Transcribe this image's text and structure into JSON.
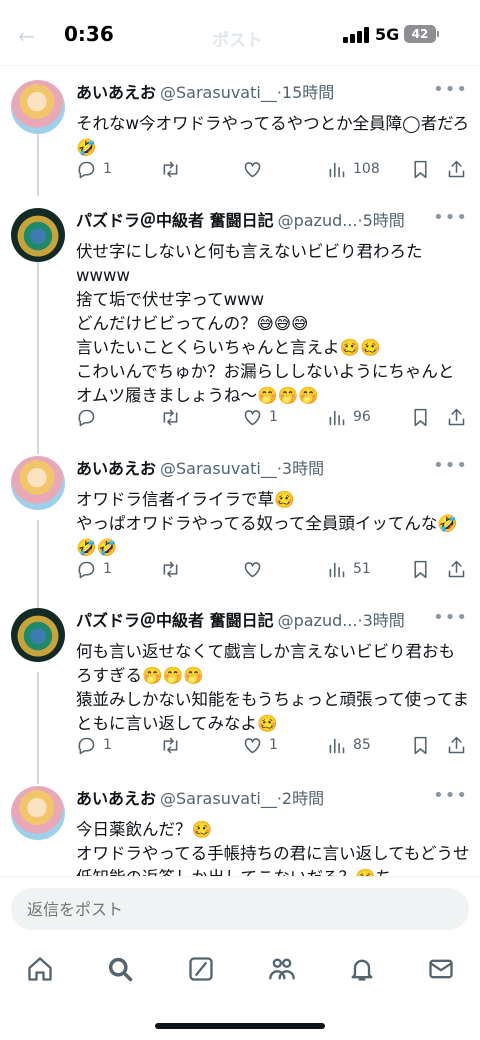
{
  "status_bar": {
    "time": "0:36",
    "network": "5G",
    "battery": "42"
  },
  "header": {
    "back_glyph": "←",
    "title": "ポスト"
  },
  "tweets": [
    {
      "name": "あいあえお",
      "handle": "@Sarasuvati__",
      "time": "15時間",
      "body": "それなw今オワドラやってるやつとか全員障◯者だろ🤣",
      "replies": "1",
      "retweets": "",
      "likes": "",
      "views": "108"
    },
    {
      "name": "パズドラ＠中級者 奮闘日記",
      "handle": "@pazud...",
      "time": "5時間",
      "body": "伏せ字にしないと何も言えないビビり君わろたwwww\n捨て垢で伏せ字ってwww\nどんだけビビってんの？😅😅😅\n言いたいことくらいちゃんと言えよ🥴🥴\nこわいんでちゅか？お漏らししないようにちゃんとオムツ履きましょうね〜🤭🤭🤭",
      "replies": "",
      "retweets": "",
      "likes": "1",
      "views": "96"
    },
    {
      "name": "あいあえお",
      "handle": "@Sarasuvati__",
      "time": "3時間",
      "body": "オワドラ信者イライラで草🥴\nやっぱオワドラやってる奴って全員頭イッてんな🤣🤣🤣",
      "replies": "1",
      "retweets": "",
      "likes": "",
      "views": "51"
    },
    {
      "name": "パズドラ＠中級者 奮闘日記",
      "handle": "@pazud...",
      "time": "3時間",
      "body": "何も言い返せなくて戯言しか言えないビビり君おもろすぎる🤭🤭🤭\n猿並みしかない知能をもうちょっと頑張って使ってまともに言い返してみなよ🥴",
      "replies": "1",
      "retweets": "",
      "likes": "1",
      "views": "85"
    },
    {
      "name": "あいあえお",
      "handle": "@Sarasuvati__",
      "time": "2時間",
      "body": "今日薬飲んだ？🥴\nオワドラやってる手帳持ちの君に言い返してもどうせ低知能の返答しか出してこないだろ？🥴ち",
      "replies": "",
      "retweets": "",
      "likes": "",
      "views": ""
    }
  ],
  "reply_bar": {
    "placeholder": "返信をポスト"
  },
  "icons": {
    "more": "more-icon",
    "reply": "reply-icon",
    "retweet": "retweet-icon",
    "like": "heart-icon",
    "views": "views-icon",
    "bookmark": "bookmark-icon",
    "share": "share-icon",
    "tabs": [
      "home-icon",
      "search-icon",
      "grok-icon",
      "communities-icon",
      "notifications-icon",
      "messages-icon"
    ]
  },
  "colors": {
    "text": "#0f1419",
    "secondary": "#536471",
    "thread_line": "#cfd9de",
    "input_bg": "#eff3f4"
  }
}
